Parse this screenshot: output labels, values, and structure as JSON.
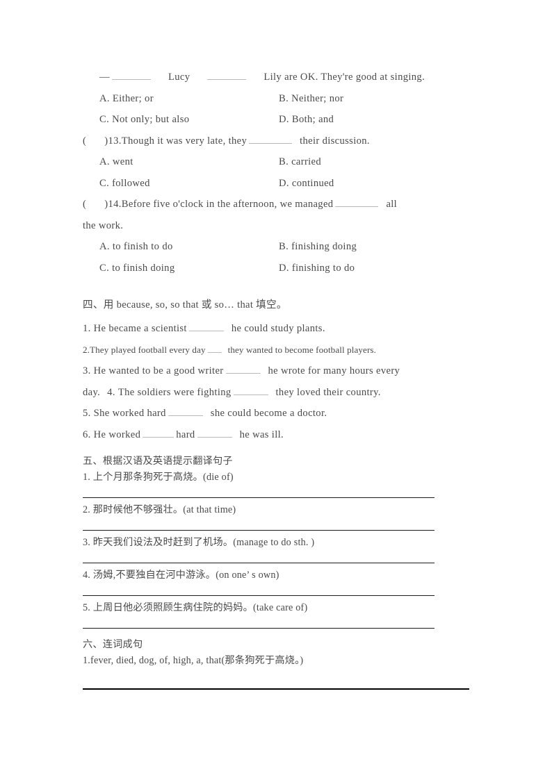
{
  "document": {
    "type": "worksheet",
    "language": "zh-CN/en",
    "page_background": "#ffffff",
    "text_color": "#4a4a4a",
    "rule_color": "#1a1a1a",
    "blank_color": "#b9b9b9"
  },
  "part_three": {
    "q12": {
      "stem_prefix": "—",
      "stem_mid": "Lucy",
      "stem_suffix": "Lily are OK. They're good at singing.",
      "options": [
        {
          "label": "A. Either; or",
          "col": "left"
        },
        {
          "label": "B. Neither; nor",
          "col": "right"
        },
        {
          "label": "C. Not only; but also",
          "col": "left"
        },
        {
          "label": "D. Both; and",
          "col": "right"
        }
      ]
    },
    "q13": {
      "bracket": "(",
      "bracket_close": ")",
      "number": "13.",
      "stem_before": "Though it was very late, they",
      "stem_after": "their discussion.",
      "options": [
        {
          "label": "A. went",
          "col": "left"
        },
        {
          "label": "B. carried",
          "col": "right"
        },
        {
          "label": "C. followed",
          "col": "left"
        },
        {
          "label": "D. continued",
          "col": "right"
        }
      ]
    },
    "q14": {
      "bracket": "(",
      "bracket_close": ")",
      "number": "14.",
      "stem_before": "Before five o'clock in the afternoon, we managed",
      "stem_after": "all",
      "stem_line2": "the work.",
      "options": [
        {
          "label": "A. to finish to do",
          "col": "left"
        },
        {
          "label": "B. finishing doing",
          "col": "right"
        },
        {
          "label": "C. to finish doing",
          "col": "left"
        },
        {
          "label": "D. finishing to do",
          "col": "right"
        }
      ]
    }
  },
  "part_four": {
    "heading": "四、用 because, so, so that 或 so… that 填空。",
    "items": [
      {
        "number": "1.",
        "before": "He became a scientist",
        "after": "he could study plants.",
        "small": false
      },
      {
        "number": "2.",
        "before": "They played football every day",
        "after": "they wanted to become football players.",
        "small": true
      },
      {
        "number": "3.",
        "before": "He wanted to be a good writer",
        "after": "he wrote for many hours every",
        "wrap": "day.",
        "small": false
      },
      {
        "number": "4.",
        "before": "The soldiers were fighting",
        "after": "they loved their country.",
        "small": false
      },
      {
        "number": "5.",
        "before": "She worked hard",
        "after": "she could become a doctor.",
        "small": false
      },
      {
        "number": "6.",
        "before": "He worked",
        "mid": "hard",
        "after": "he was ill.",
        "small": false
      }
    ]
  },
  "part_five": {
    "heading": "五、根据汉语及英语提示翻译句子",
    "items": [
      {
        "number": "1.",
        "text": "上个月那条狗死于高烧。(die of)"
      },
      {
        "number": "2.",
        "text": "那时候他不够强壮。(at that time)"
      },
      {
        "number": "3.",
        "text": "昨天我们设法及时赶到了机场。(manage to do sth. )"
      },
      {
        "number": "4.",
        "text": "汤姆,不要独自在河中游泳。(on one’ s own)"
      },
      {
        "number": "5.",
        "text": "上周日他必须照顾生病住院的妈妈。(take care of)"
      }
    ]
  },
  "part_six": {
    "heading": "六、连词成句",
    "items": [
      {
        "number": "1.",
        "text": "fever, died, dog, of, high, a, that(那条狗死于高烧。)"
      }
    ]
  }
}
